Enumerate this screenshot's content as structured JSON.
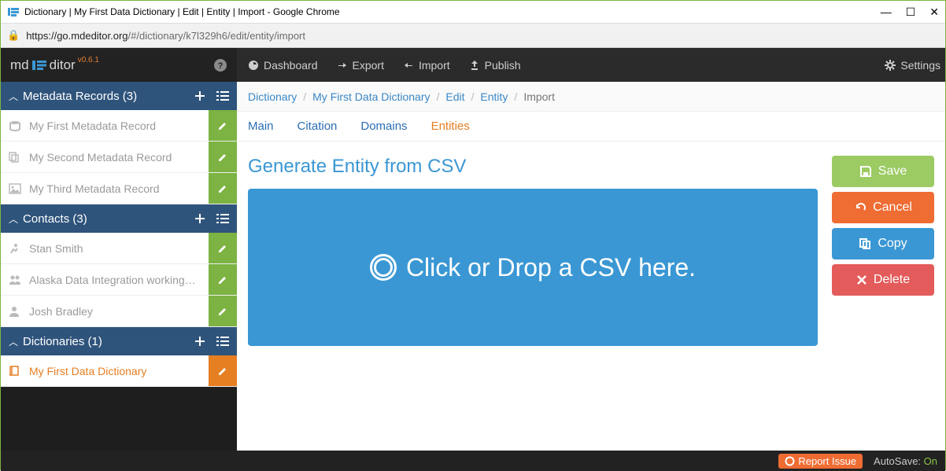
{
  "chrome": {
    "title": "Dictionary | My First Data Dictionary | Edit | Entity | Import - Google Chrome",
    "url_host": "https://go.mdeditor.org",
    "url_path": "/#/dictionary/k7l329h6/edit/entity/import"
  },
  "brand": {
    "md": "md",
    "ditor": "ditor",
    "version": "v0.6.1"
  },
  "topnav": {
    "dashboard": "Dashboard",
    "export": "Export",
    "import": "Import",
    "publish": "Publish",
    "settings": "Settings"
  },
  "sidebar": {
    "sections": {
      "metadata": {
        "title": "Metadata Records (3)",
        "items": [
          "My First Metadata Record",
          "My Second Metadata Record",
          "My Third Metadata Record"
        ]
      },
      "contacts": {
        "title": "Contacts (3)",
        "items": [
          "Stan Smith",
          "Alaska Data Integration working…",
          "Josh Bradley"
        ]
      },
      "dictionaries": {
        "title": "Dictionaries (1)",
        "items": [
          "My First Data Dictionary"
        ]
      }
    }
  },
  "breadcrumb": {
    "b0": "Dictionary",
    "b1": "My First Data Dictionary",
    "b2": "Edit",
    "b3": "Entity",
    "b4": "Import"
  },
  "subnav": {
    "main": "Main",
    "citation": "Citation",
    "domains": "Domains",
    "entities": "Entities"
  },
  "page": {
    "heading": "Generate Entity from CSV",
    "drop_text": "Click or Drop a CSV here."
  },
  "actions": {
    "save": "Save",
    "cancel": "Cancel",
    "copy": "Copy",
    "delete": "Delete"
  },
  "footer": {
    "report": "Report Issue",
    "autosave_label": "AutoSave: ",
    "autosave_value": "On"
  }
}
